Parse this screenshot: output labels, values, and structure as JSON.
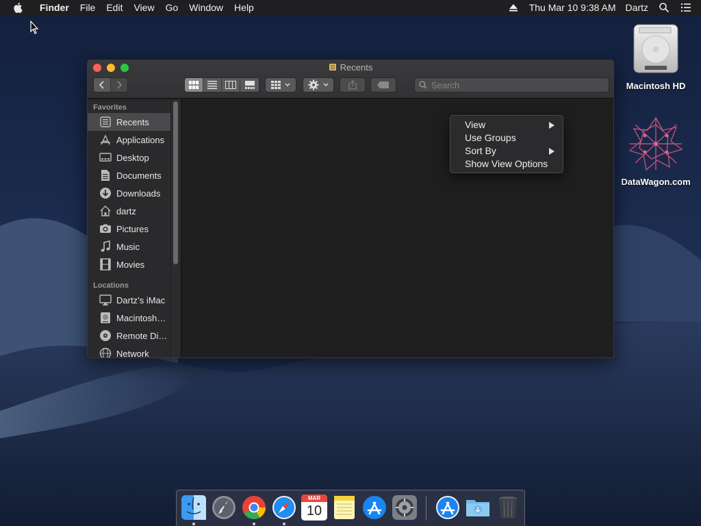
{
  "menubar": {
    "app_name": "Finder",
    "items": [
      "File",
      "Edit",
      "View",
      "Go",
      "Window",
      "Help"
    ],
    "clock": "Thu Mar 10  9:38 AM",
    "user": "Dartz",
    "icons": [
      "apple-icon",
      "eject-icon",
      "spotlight-icon",
      "notification-center-icon"
    ]
  },
  "desktop": {
    "icons": [
      {
        "label": "Macintosh HD",
        "icon": "hard-drive-icon"
      },
      {
        "label": "DataWagon.com",
        "icon": "datawagon-icon"
      }
    ]
  },
  "window": {
    "title": "Recents",
    "search_placeholder": "Search",
    "toolbar_icons": [
      "back-icon",
      "forward-icon",
      "icon-view-icon",
      "list-view-icon",
      "column-view-icon",
      "gallery-view-icon",
      "group-icon",
      "gear-icon",
      "share-icon",
      "tag-icon"
    ],
    "sidebar": {
      "favorites_label": "Favorites",
      "favorites": [
        {
          "label": "Recents",
          "icon": "recents-icon",
          "selected": true
        },
        {
          "label": "Applications",
          "icon": "applications-icon"
        },
        {
          "label": "Desktop",
          "icon": "desktop-icon"
        },
        {
          "label": "Documents",
          "icon": "documents-icon"
        },
        {
          "label": "Downloads",
          "icon": "downloads-icon"
        },
        {
          "label": "dartz",
          "icon": "home-icon"
        },
        {
          "label": "Pictures",
          "icon": "pictures-icon"
        },
        {
          "label": "Music",
          "icon": "music-icon"
        },
        {
          "label": "Movies",
          "icon": "movies-icon"
        }
      ],
      "locations_label": "Locations",
      "locations": [
        {
          "label": "Dartz’s iMac",
          "icon": "imac-icon"
        },
        {
          "label": "Macintosh…",
          "icon": "disk-icon"
        },
        {
          "label": "Remote Di…",
          "icon": "remote-disc-icon"
        },
        {
          "label": "Network",
          "icon": "network-icon"
        }
      ]
    }
  },
  "context_menu": {
    "items": [
      {
        "label": "View",
        "submenu": true
      },
      {
        "label": "Use Groups",
        "submenu": false
      },
      {
        "label": "Sort By",
        "submenu": true
      },
      {
        "label": "Show View Options",
        "submenu": false
      }
    ]
  },
  "dock": {
    "apps": [
      "finder-icon",
      "launchpad-icon",
      "chrome-icon",
      "safari-icon",
      "calendar-icon",
      "notes-icon",
      "app-store-icon",
      "system-preferences-icon",
      "app-store-downloads-icon",
      "downloads-folder-icon",
      "trash-icon"
    ],
    "calendar_month": "MAR",
    "calendar_day": "10"
  },
  "colors": {
    "menubar": "#1f1f22",
    "window_bg": "#1e1e1e",
    "sidebar_bg": "#2a2a2c",
    "close": "#fe5f57",
    "minimize": "#febc2e",
    "zoom": "#28c840"
  }
}
